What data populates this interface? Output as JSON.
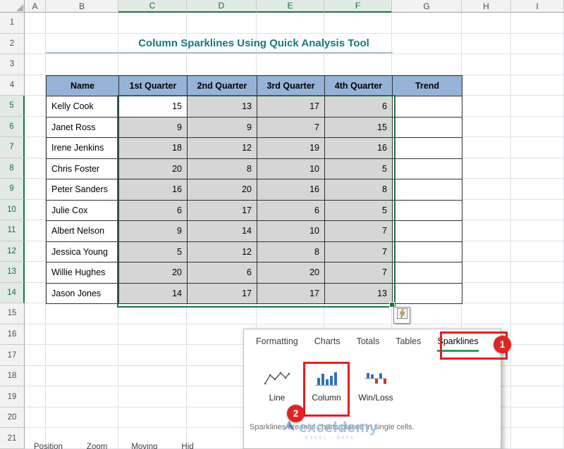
{
  "spreadsheet": {
    "col_headers": [
      "A",
      "B",
      "C",
      "D",
      "E",
      "F",
      "G",
      "H",
      "I"
    ],
    "row_numbers": [
      "1",
      "2",
      "3",
      "4",
      "5",
      "6",
      "7",
      "8",
      "9",
      "10",
      "11",
      "12",
      "13",
      "14",
      "15",
      "16",
      "17",
      "18",
      "19",
      "20",
      "21"
    ],
    "selected_columns": [
      "C",
      "D",
      "E",
      "F"
    ],
    "selected_rows": [
      "5",
      "6",
      "7",
      "8",
      "9",
      "10",
      "11",
      "12",
      "13",
      "14"
    ]
  },
  "title": {
    "text": "Column Sparklines Using Quick Analysis Tool"
  },
  "table": {
    "headers": [
      "Name",
      "1st Quarter",
      "2nd Quarter",
      "3rd Quarter",
      "4th Quarter",
      "Trend"
    ],
    "rows": [
      {
        "name": "Kelly Cook",
        "values": [
          15,
          13,
          17,
          6
        ]
      },
      {
        "name": "Janet Ross",
        "values": [
          9,
          9,
          7,
          15
        ]
      },
      {
        "name": "Irene Jenkins",
        "values": [
          18,
          12,
          19,
          16
        ]
      },
      {
        "name": "Chris Foster",
        "values": [
          20,
          8,
          10,
          5
        ]
      },
      {
        "name": "Peter Sanders",
        "values": [
          16,
          20,
          16,
          8
        ]
      },
      {
        "name": "Julie Cox",
        "values": [
          6,
          17,
          6,
          5
        ]
      },
      {
        "name": "Albert Nelson",
        "values": [
          9,
          14,
          10,
          7
        ]
      },
      {
        "name": "Jessica Young",
        "values": [
          5,
          12,
          8,
          7
        ]
      },
      {
        "name": "Willie Hughes",
        "values": [
          20,
          6,
          20,
          7
        ]
      },
      {
        "name": "Jason Jones",
        "values": [
          14,
          17,
          17,
          13
        ]
      }
    ]
  },
  "quick_analysis": {
    "button_icon": "quick-analysis-lightning-icon",
    "tabs": [
      "Formatting",
      "Charts",
      "Totals",
      "Tables",
      "Sparklines"
    ],
    "active_tab": "Sparklines",
    "options": [
      {
        "label": "Line",
        "icon": "line-sparkline-icon"
      },
      {
        "label": "Column",
        "icon": "column-sparkline-icon",
        "highlighted": true
      },
      {
        "label": "Win/Loss",
        "icon": "winloss-sparkline-icon"
      }
    ],
    "tooltip": "Sparklines are mini charts placed in single cells."
  },
  "annotations": {
    "steps": [
      "1",
      "2"
    ]
  },
  "watermark": {
    "text": "exceldemy",
    "subtext": "EXCEL - DATA"
  },
  "sheet_tabs": [
    "Position",
    "Zoom",
    "Moving",
    "Hid"
  ],
  "colors": {
    "header_fill": "#95B3D7",
    "selection_fill": "#D6D6D6",
    "selection_green": "#1E7145",
    "active_tab_green": "#21A366",
    "annotation_red": "#E21F1F",
    "title_teal": "#17777D",
    "sparkline_blue": "#2E74B5",
    "winloss_red": "#C0392B",
    "watermark_blue": "#8FB7DC"
  }
}
